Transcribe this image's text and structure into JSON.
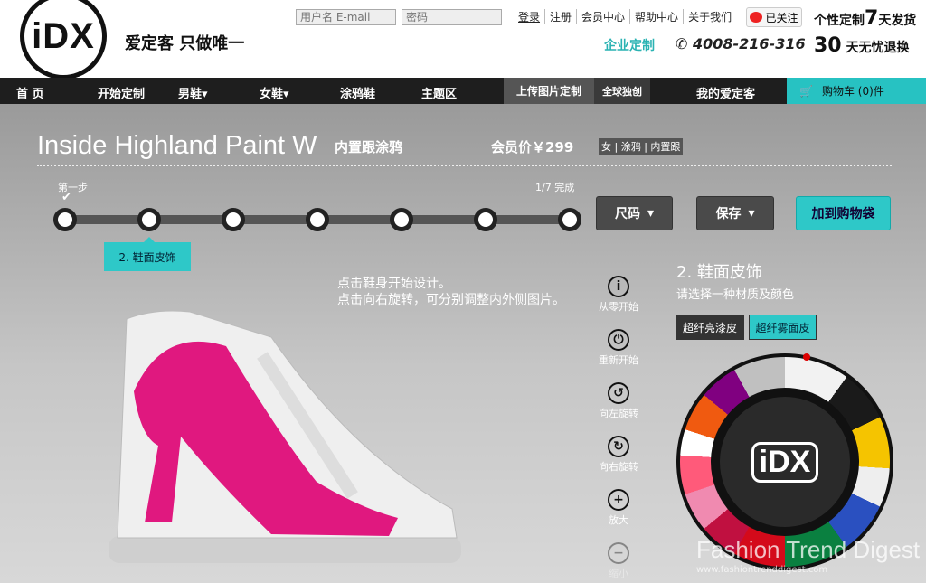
{
  "header": {
    "logo": "iDX",
    "slogan": "爱定客 只做唯一",
    "username_placeholder": "用户名 E-mail",
    "password_placeholder": "密码",
    "links": [
      "登录",
      "注册",
      "会员中心",
      "帮助中心",
      "关于我们"
    ],
    "follow": "已关注",
    "enterprise": "企业定制",
    "phone": "4008-216-316",
    "promo1": {
      "pre": "个性定制",
      "num": "7",
      "post": "天发货"
    },
    "promo2": {
      "num": "30",
      "post": "天无忧退换"
    }
  },
  "nav": {
    "items": [
      "首 页",
      "开始定制",
      "男鞋▾",
      "女鞋▾",
      "涂鸦鞋",
      "主题区"
    ],
    "upload": "上传图片定制",
    "global": "全球独创",
    "my": "我的爱定客",
    "cart": "购物车 (0)件"
  },
  "product": {
    "title": "Inside Highland Paint W",
    "subtitle": "内置跟涂鸦",
    "price": "会员价￥299",
    "tags": "女 | 涂鸦 | 内置跟"
  },
  "steps": {
    "first": "第一步",
    "count": "1/7 完成",
    "current_label": "2. 鞋面皮饰",
    "total": 7
  },
  "buttons": {
    "size": "尺码",
    "save": "保存",
    "add_to_cart": "加到购物袋"
  },
  "hint": {
    "line1": "点击鞋身开始设计。",
    "line2": "点击向右旋转，可分别调整内外侧图片。"
  },
  "tools": [
    {
      "icon": "info-icon",
      "glyph": "i",
      "label": "从零开始"
    },
    {
      "icon": "power-icon",
      "glyph": "⏻",
      "label": "重新开始"
    },
    {
      "icon": "rotate-left-icon",
      "glyph": "↺",
      "label": "向左旋转"
    },
    {
      "icon": "rotate-right-icon",
      "glyph": "↻",
      "label": "向右旋转"
    },
    {
      "icon": "zoom-in-icon",
      "glyph": "+",
      "label": "放大"
    },
    {
      "icon": "zoom-out-icon",
      "glyph": "−",
      "label": "缩小"
    }
  ],
  "panel": {
    "title": "2. 鞋面皮饰",
    "subtitle": "请选择一种材质及颜色",
    "material1": "超纤亮漆皮",
    "material2": "超纤雾面皮",
    "wheel_logo": "iDX"
  },
  "watermark": {
    "text": "Fashion Trend Digest",
    "url": "www.fashiontrenddigest.com"
  }
}
